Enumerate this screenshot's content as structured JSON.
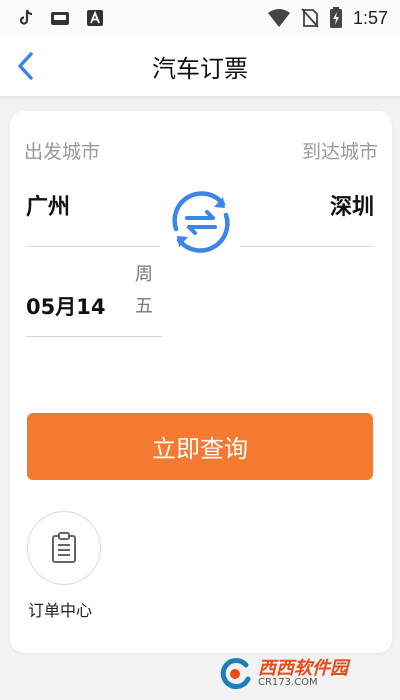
{
  "status_bar": {
    "time": "1:57",
    "left_icons": [
      "tiktok-icon",
      "tv-icon",
      "text-a-icon"
    ],
    "right_icons": [
      "wifi-icon",
      "no-sim-icon",
      "battery-charging-icon"
    ]
  },
  "header": {
    "title": "汽车订票",
    "back_icon": "chevron-left-icon"
  },
  "route": {
    "from_label": "出发城市",
    "to_label": "到达城市",
    "from_city": "广州",
    "to_city": "深圳",
    "swap_icon": "swap-arrows-icon"
  },
  "date": {
    "value": "05月14",
    "weekday_1": "周",
    "weekday_2": "五"
  },
  "search_button": {
    "label": "立即查询"
  },
  "orders": {
    "label": "订单中心",
    "icon": "clipboard-icon"
  },
  "watermark": {
    "title": "西西软件园",
    "url": "CR173.COM"
  },
  "colors": {
    "accent_orange": "#f47a2f",
    "accent_blue": "#3b86e6",
    "header_bg": "#ffffff",
    "page_bg": "#f2f2f2"
  }
}
